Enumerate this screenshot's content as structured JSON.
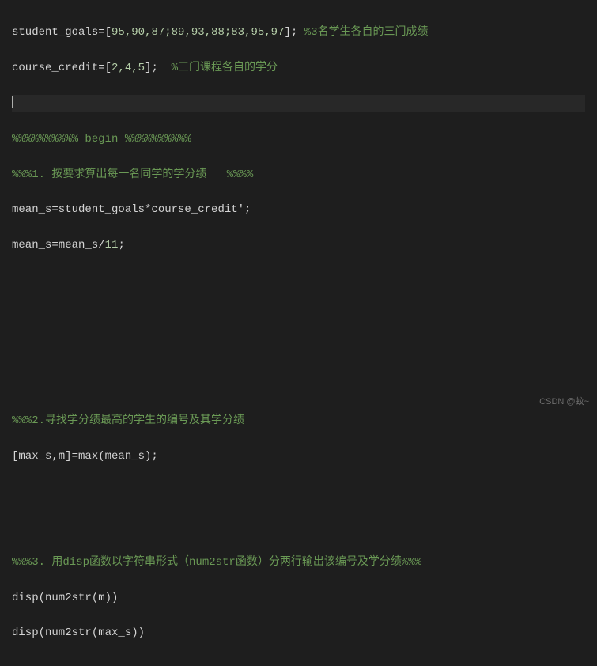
{
  "code": {
    "line1": {
      "prefix": "student_goals=[",
      "numbers": "95,90,87;89,93,88;83,95,97",
      "suffix": "]; ",
      "comment": "%3名学生各自的三门成绩"
    },
    "line2": {
      "prefix": "course_credit=[",
      "numbers": "2,4,5",
      "suffix": "];  ",
      "comment": "%三门课程各自的学分"
    },
    "line3": "",
    "line4": "%%%%%%%%%% begin %%%%%%%%%%",
    "line5": {
      "prefix": "%%%1. 按要求算出每一名同学的学分绩   ",
      "suffix": "%%%%"
    },
    "line6": "mean_s=student_goals*course_credit';",
    "line7": {
      "prefix": "mean_s=mean_s/",
      "number": "11",
      "suffix": ";"
    },
    "line8": "",
    "line9": "",
    "line10": "",
    "line11": "",
    "line12": "%%%2.寻找学分绩最高的学生的编号及其学分绩",
    "line13": "[max_s,m]=max(mean_s);",
    "line14": "",
    "line15": "",
    "line16": "%%%3. 用disp函数以字符串形式（num2str函数）分两行输出该编号及学分绩%%%",
    "line17": "disp(num2str(m))",
    "line18": "disp(num2str(max_s))"
  },
  "watermark": "CSDN @蚊~"
}
